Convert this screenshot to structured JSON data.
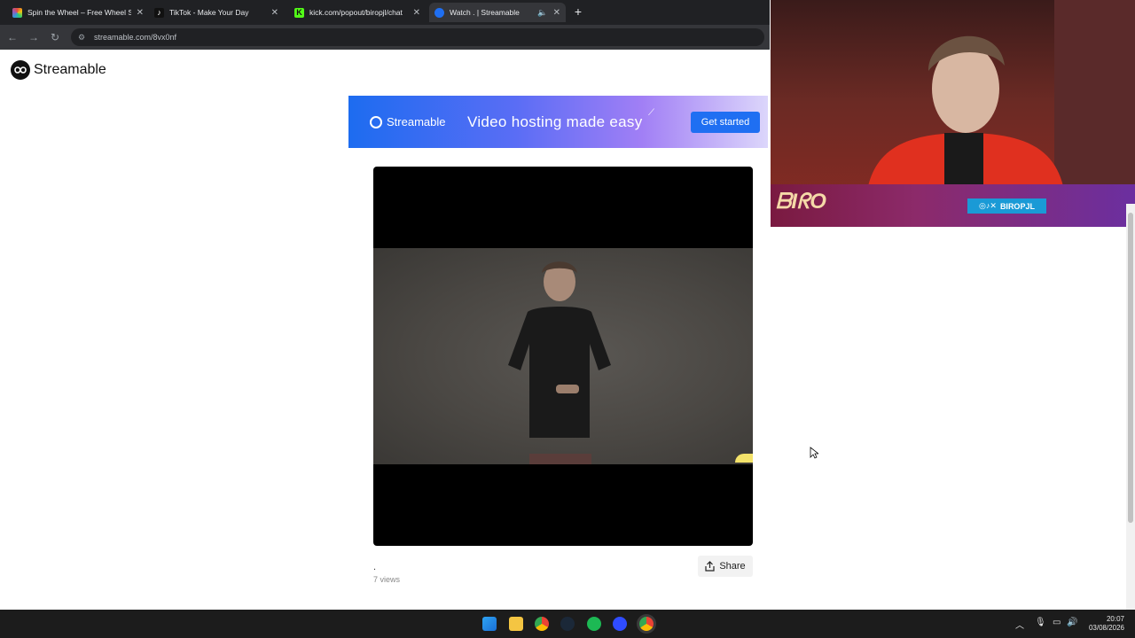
{
  "browser": {
    "tabs": [
      {
        "label": "Spin the Wheel – Free Wheel Sp",
        "favicon": "wheel-favicon",
        "color": "#e74c3c"
      },
      {
        "label": "TikTok - Make Your Day",
        "favicon": "tiktok-favicon",
        "color": "#000000"
      },
      {
        "label": "kick.com/popout/biropjl/chat",
        "favicon": "kick-favicon",
        "color": "#53fc18"
      },
      {
        "label": "Watch . | Streamable",
        "favicon": "streamable-favicon",
        "color": "#1f6ff2"
      }
    ],
    "url": "streamable.com/8vx0nf"
  },
  "page": {
    "logo_text": "Streamable",
    "banner": {
      "logo_text": "Streamable",
      "headline": "Video hosting made easy",
      "cta": "Get started"
    },
    "video": {
      "title": ".",
      "views": "7 views",
      "share_label": "Share"
    }
  },
  "webcam": {
    "overlay_name": "BIROPJL"
  },
  "taskbar": {
    "time": "20:07",
    "date": "03/08/2026"
  }
}
